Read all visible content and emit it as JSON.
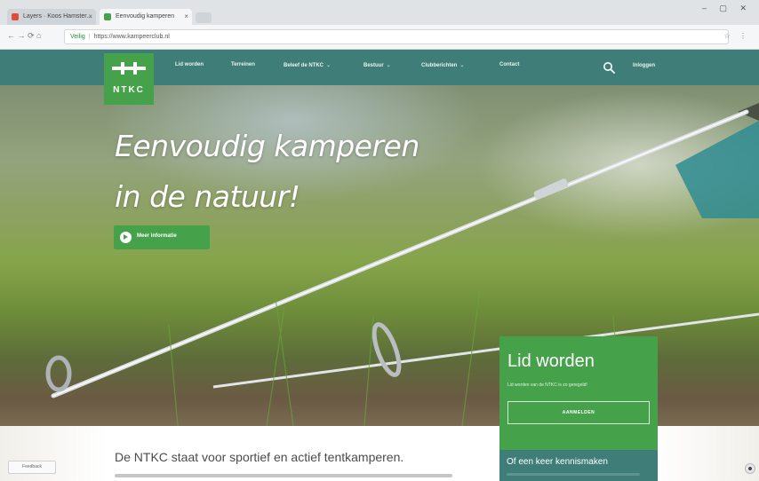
{
  "browser": {
    "tabs": [
      {
        "label": "Layers · Koos Hamster...",
        "fav_color": "#e04b3a"
      },
      {
        "label": "Eenvoudig kamperen",
        "fav_color": "#46a24a"
      }
    ],
    "url_security": "Veilig",
    "url": "https://www.kampeerclub.nl",
    "nav_icons": "← → ⟳ ⌂",
    "toolbar_icons": "☆ ⋮",
    "window_controls": "– ▢ ✕"
  },
  "site": {
    "logo_text": "NTKC",
    "nav": [
      {
        "label": "Lid worden",
        "dropdown": false
      },
      {
        "label": "Terreinen",
        "dropdown": false
      },
      {
        "label": "Beleef de NTKC",
        "dropdown": true
      },
      {
        "label": "Bestuur",
        "dropdown": true
      },
      {
        "label": "Clubberichten",
        "dropdown": true
      },
      {
        "label": "Contact",
        "dropdown": false
      }
    ],
    "login_label": "Inloggen"
  },
  "hero": {
    "title_line1": "Eenvoudig kamperen",
    "title_line2": "in de natuur!",
    "cta_label": "Meer informatie"
  },
  "card": {
    "title": "Lid worden",
    "subtitle": "Lid worden van de NTKC is zo geregeld!",
    "button_label": "AANMELDEN"
  },
  "card2": {
    "title": "Of een keer kennismaken"
  },
  "lower": {
    "tagline": "De NTKC staat voor sportief en actief tentkamperen."
  },
  "feedback_label": "Feedback",
  "colors": {
    "brand_green": "#46a24a",
    "brand_teal": "#3f7d78"
  }
}
